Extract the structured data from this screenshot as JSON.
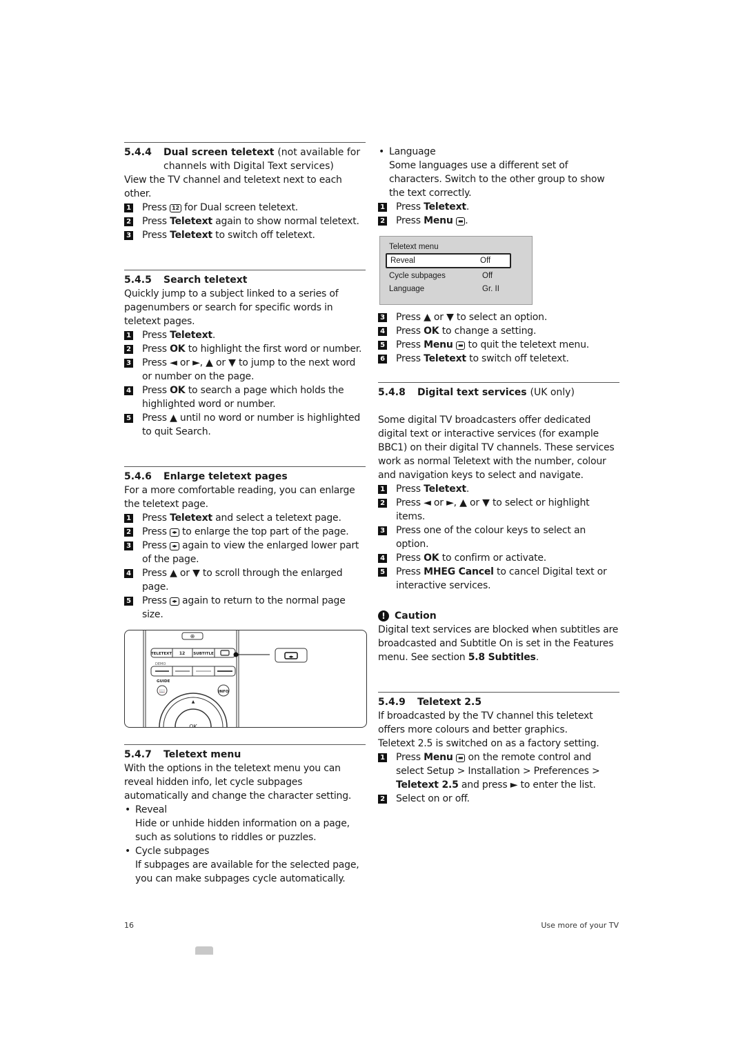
{
  "sections": {
    "s544": {
      "number": "5.4.4",
      "title": "Dual screen teletext",
      "note": "(not available for",
      "note2": "channels with Digital Text services)",
      "intro": "View the TV channel and teletext next to each other.",
      "steps": [
        {
          "n": "1",
          "pre": "Press ",
          "key": "12",
          "post": " for Dual screen teletext."
        },
        {
          "n": "2",
          "pre": "Press ",
          "bold": "Teletext",
          "post": " again to show normal teletext."
        },
        {
          "n": "3",
          "pre": "Press ",
          "bold": "Teletext",
          "post": " to switch off teletext."
        }
      ]
    },
    "s545": {
      "number": "5.4.5",
      "title": "Search teletext",
      "intro": "Quickly jump to a subject linked to a series of pagenumbers or search for specific words in teletext pages.",
      "steps": [
        {
          "n": "1",
          "pre": "Press ",
          "bold": "Teletext",
          "post": "."
        },
        {
          "n": "2",
          "pre": "Press ",
          "bold": "OK",
          "post": " to highlight the first word or number."
        },
        {
          "n": "3",
          "text": "Press ◄ or ►, ▲ or ▼ to jump to the next word or number on the page."
        },
        {
          "n": "4",
          "pre": "Press ",
          "bold": "OK",
          "post": " to search a page which holds the highlighted word or number."
        },
        {
          "n": "5",
          "text": "Press ▲ until no word or number is highlighted to quit Search."
        }
      ]
    },
    "s546": {
      "number": "5.4.6",
      "title": "Enlarge teletext pages",
      "intro": "For a more comfortable reading, you can enlarge the teletext page.",
      "steps": [
        {
          "n": "1",
          "pre": "Press ",
          "bold": "Teletext",
          "post": " and select a teletext page."
        },
        {
          "n": "2",
          "pre": "Press ",
          "key": "◂▸",
          "post": " to enlarge the top part of the page."
        },
        {
          "n": "3",
          "pre": "Press ",
          "key": "◂▸",
          "post": " again to view the enlarged lower part of the page."
        },
        {
          "n": "4",
          "text": "Press ▲ or ▼ to scroll through the enlarged page."
        },
        {
          "n": "5",
          "pre": "Press ",
          "key": "◂▸",
          "post": " again to return to the normal page size."
        }
      ]
    },
    "remote": {
      "teletext": "TELETEXT",
      "dual": "12",
      "subtitle": "SUBTITLE",
      "demo": "DEMO",
      "guide": "GUIDE",
      "info": "INFO",
      "ok": "OK"
    },
    "s547": {
      "number": "5.4.7",
      "title": "Teletext menu",
      "intro": "With the options in the teletext menu you can reveal hidden info, let cycle subpages automatically and change the character setting.",
      "bullets": [
        {
          "title": "Reveal",
          "desc": "Hide or unhide hidden information on a page, such as solutions to riddles or puzzles."
        },
        {
          "title": "Cycle subpages",
          "desc": "If subpages are available for the selected page, you can make subpages cycle automatically."
        },
        {
          "title": "Language",
          "desc": "Some languages use a different set of characters. Switch to the other group to show the text correctly."
        }
      ],
      "steps_a": [
        {
          "n": "1",
          "pre": "Press ",
          "bold": "Teletext",
          "post": "."
        },
        {
          "n": "2",
          "pre": "Press ",
          "bold": "Menu",
          "post": "."
        }
      ],
      "menu": {
        "title": "Teletext menu",
        "rows": [
          {
            "label": "Reveal",
            "value": "Off",
            "selected": true
          },
          {
            "label": "Cycle subpages",
            "value": "Off",
            "selected": false
          },
          {
            "label": "Language",
            "value": "Gr. II",
            "selected": false
          }
        ]
      },
      "steps_b": [
        {
          "n": "3",
          "text": "Press ▲ or ▼ to select an option."
        },
        {
          "n": "4",
          "pre": "Press ",
          "bold": "OK",
          "post": " to change a setting."
        },
        {
          "n": "5",
          "pre": "Press ",
          "bold": "Menu",
          "post": " to quit the teletext menu."
        },
        {
          "n": "6",
          "pre": "Press ",
          "bold": "Teletext",
          "post": " to switch off teletext."
        }
      ]
    },
    "s548": {
      "number": "5.4.8",
      "title": "Digital text services",
      "note": "(UK only)",
      "intro": "Some digital TV broadcasters offer dedicated digital text or interactive services (for example BBC1) on their digital TV channels. These services work as normal Teletext with the number, colour and navigation keys to select and navigate.",
      "steps": [
        {
          "n": "1",
          "pre": "Press ",
          "bold": "Teletext",
          "post": "."
        },
        {
          "n": "2",
          "text": "Press ◄ or ►, ▲ or ▼ to select or highlight items."
        },
        {
          "n": "3",
          "text": "Press one of the colour keys to select an option."
        },
        {
          "n": "4",
          "pre": "Press ",
          "bold": "OK",
          "post": " to confirm or activate."
        },
        {
          "n": "5",
          "pre": "Press ",
          "bold": "MHEG Cancel",
          "post": " to cancel Digital text or interactive services."
        }
      ],
      "caution": {
        "title": "Caution",
        "pre": "Digital text services are blocked when subtitles are broadcasted and Subtitle On is set in the Features menu. See section ",
        "bold": "5.8 Subtitles",
        "post": "."
      }
    },
    "s549": {
      "number": "5.4.9",
      "title": "Teletext 2.5",
      "intro1": "If broadcasted by the TV channel this teletext offers more colours and better graphics.",
      "intro2": "Teletext 2.5 is switched on as a factory setting.",
      "step1": {
        "n": "1",
        "pre": "Press ",
        "bold1": "Menu",
        "mid": " on the remote control and select Setup > Installation > Preferences > ",
        "bold2": "Teletext 2.5",
        "post": " and press ► to enter the list."
      },
      "step2": {
        "n": "2",
        "text": "Select on or off."
      }
    }
  },
  "footer": {
    "page_number": "16",
    "chapter": "Use more of your TV"
  }
}
